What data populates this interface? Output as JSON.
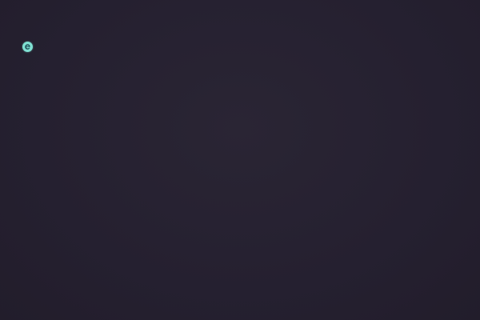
{
  "desktop": {
    "background_color": "#262130",
    "icons": [
      {
        "icon": "edge-browser-icon",
        "color": "#7fe0d2"
      }
    ]
  }
}
